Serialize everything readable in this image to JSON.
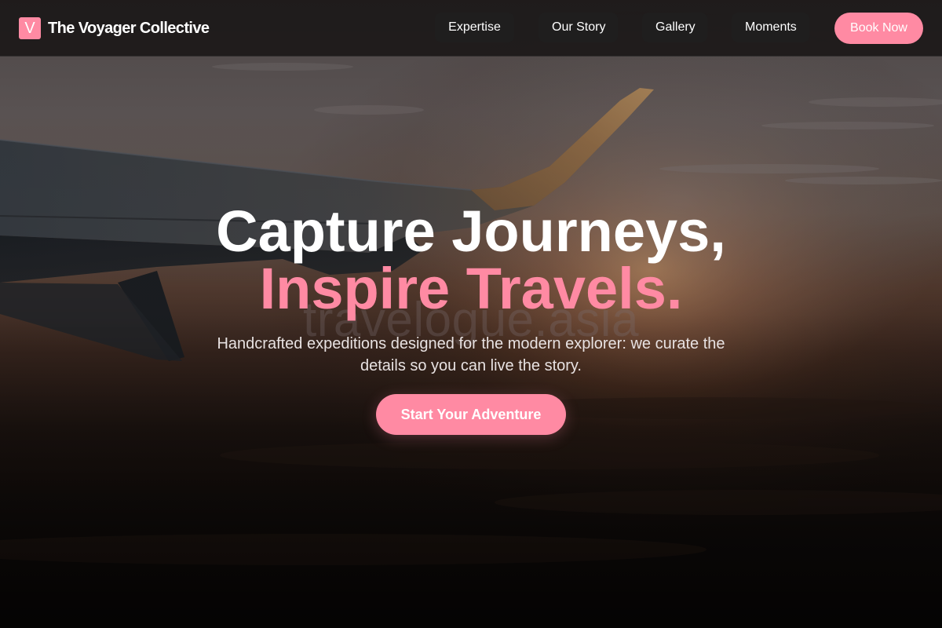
{
  "brand": {
    "logo_letter": "V",
    "name": "The Voyager Collective"
  },
  "nav": {
    "links": [
      {
        "label": "Expertise"
      },
      {
        "label": "Our Story"
      },
      {
        "label": "Gallery"
      },
      {
        "label": "Moments"
      }
    ],
    "cta_label": "Book Now"
  },
  "hero": {
    "headline_line1": "Capture Journeys,",
    "headline_line2": "Inspire Travels.",
    "watermark": "travelogue.asia",
    "subtitle": "Handcrafted expeditions designed for the modern explorer: we curate the details so you can live the story.",
    "cta_label": "Start Your Adventure",
    "background_image": "airplane-wing-sunset-photo"
  },
  "colors": {
    "accent": "#ff8aa3",
    "nav_background": "#120f10",
    "text_primary": "#ffffff"
  }
}
